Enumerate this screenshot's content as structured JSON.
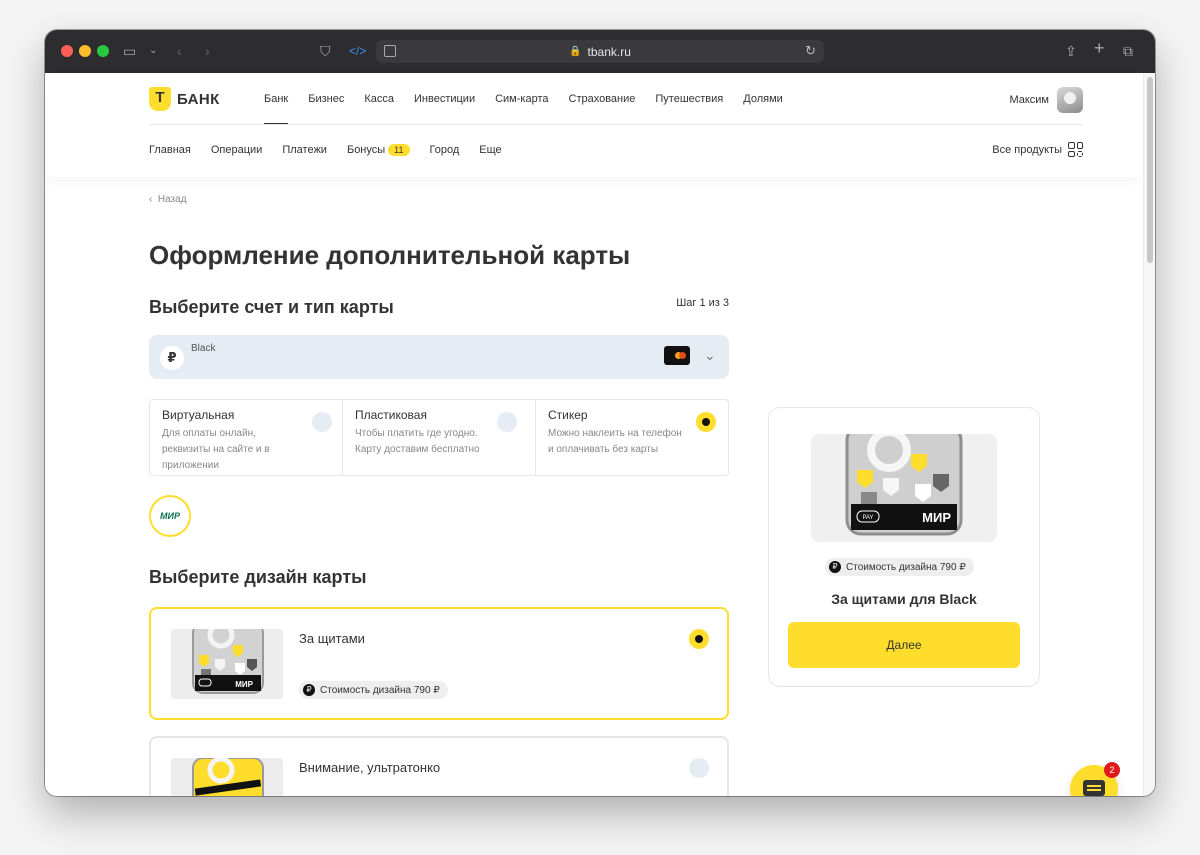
{
  "browser": {
    "url": "tbank.ru"
  },
  "header": {
    "logo_text": "БАНК",
    "nav": [
      "Банк",
      "Бизнес",
      "Касса",
      "Инвестиции",
      "Сим-карта",
      "Страхование",
      "Путешествия",
      "Долями"
    ],
    "active_nav": "Банк",
    "user_name": "Максим",
    "subnav": [
      "Главная",
      "Операции",
      "Платежи",
      "Бонусы",
      "Город",
      "Еще"
    ],
    "bonus_badge": "11",
    "all_products": "Все продукты"
  },
  "page": {
    "back": "Назад",
    "title": "Оформление дополнительной карты",
    "section_account": "Выберите счет и тип карты",
    "step": "Шаг 1 из 3",
    "account_name": "Black",
    "account_currency_symbol": "₽",
    "card_types": [
      {
        "title": "Виртуальная",
        "desc": "Для оплаты онлайн, реквизиты на сайте и в приложении",
        "selected": false
      },
      {
        "title": "Пластиковая",
        "desc": "Чтобы платить где угодно. Карту доставим бесплатно",
        "selected": false
      },
      {
        "title": "Стикер",
        "desc": "Можно наклеить на телефон и оплачивать без карты",
        "selected": true
      }
    ],
    "payment_system": "МИР",
    "section_design": "Выберите дизайн карты",
    "designs": [
      {
        "title": "За щитами",
        "price": "Стоимость дизайна 790 ₽",
        "selected": true
      },
      {
        "title": "Внимание, ультратонко",
        "price": "",
        "selected": false
      }
    ]
  },
  "summary": {
    "price": "Стоимость дизайна 790 ₽",
    "title": "За щитами для Black",
    "button": "Далее",
    "card_brand": "МИР",
    "pay_label": "PAY"
  },
  "chat": {
    "count": "2"
  },
  "colors": {
    "accent": "#ffdd2d",
    "text": "#333333",
    "account_bg": "#e5ecf4"
  }
}
